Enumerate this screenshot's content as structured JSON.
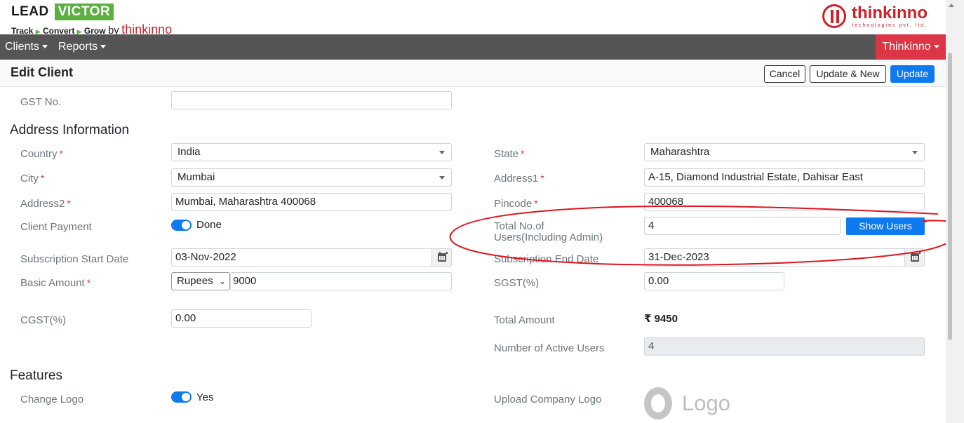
{
  "brand": {
    "lead": "LEAD",
    "victor": "VICTOR",
    "tagline_track": "Track",
    "tagline_convert": "Convert",
    "tagline_grow": "Grow",
    "tagline_by": "by",
    "tagline_company": "thinkinno",
    "corp_name": "thinkinno",
    "corp_sub": "technologies pvt. ltd."
  },
  "nav": {
    "clients": "Clients",
    "reports": "Reports",
    "user": "Thinkinno"
  },
  "page": {
    "title": "Edit Client",
    "cancel": "Cancel",
    "update_new": "Update & New",
    "update": "Update"
  },
  "form": {
    "gst_label": "GST No.",
    "gst_value": "",
    "address_section": "Address Information",
    "country_label": "Country",
    "country_value": "India",
    "state_label": "State",
    "state_value": "Maharashtra",
    "city_label": "City",
    "city_value": "Mumbai",
    "address1_label": "Address1",
    "address1_value": "A-15, Diamond Industrial Estate, Dahisar East",
    "address2_label": "Address2",
    "address2_value": "Mumbai, Maharashtra 400068",
    "pincode_label": "Pincode",
    "pincode_value": "400068",
    "client_payment_label": "Client Payment",
    "client_payment_value": "Done",
    "total_users_label_1": "Total No.of",
    "total_users_label_2": "Users(Including Admin)",
    "total_users_value": "4",
    "show_users": "Show Users",
    "sub_start_label": "Subscription Start Date",
    "sub_start_value": "03-Nov-2022",
    "sub_end_label": "Subscription End Date",
    "sub_end_value": "31-Dec-2023",
    "basic_amount_label": "Basic Amount",
    "currency_value": "Rupees",
    "basic_amount_value": "9000",
    "sgst_label": "SGST(%)",
    "sgst_value": "0.00",
    "cgst_label": "CGST(%)",
    "cgst_value": "0.00",
    "total_amount_label": "Total Amount",
    "total_amount_value": "₹ 9450",
    "active_users_label": "Number of Active Users",
    "active_users_value": "4",
    "features_section": "Features",
    "change_logo_label": "Change Logo",
    "change_logo_value": "Yes",
    "upload_logo_label": "Upload Company Logo",
    "logo_placeholder": "Logo"
  },
  "annotation": {
    "color": "#e0141e"
  }
}
